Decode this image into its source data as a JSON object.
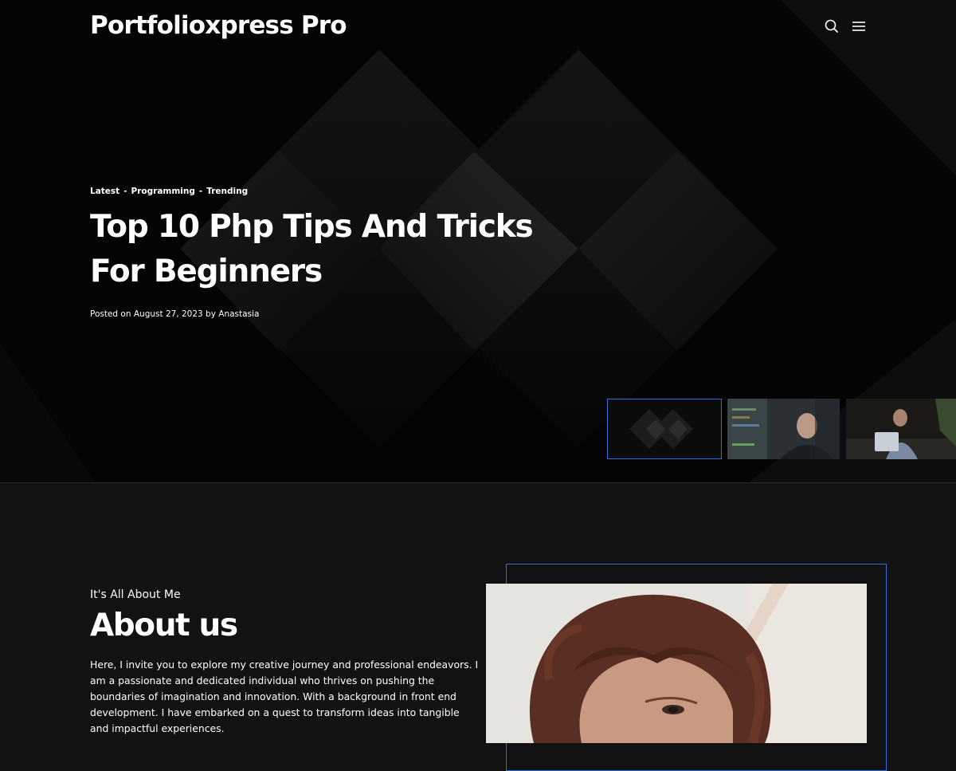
{
  "site": {
    "title": "Portfolioxpress Pro"
  },
  "header": {
    "search_icon": "search-icon",
    "menu_icon": "hamburger-menu-icon"
  },
  "slide": {
    "categories": [
      "Latest",
      "Programming",
      "Trending"
    ],
    "separator": "-",
    "title": "Top 10 Php Tips And Tricks For Beginners",
    "posted_prefix": "Posted on",
    "date": "August 27, 2023",
    "by_prefix": "by",
    "author": "Anastasia"
  },
  "thumbnails": [
    {
      "label": "slide-1",
      "active": true
    },
    {
      "label": "slide-2",
      "active": false
    },
    {
      "label": "slide-3",
      "active": false
    }
  ],
  "about": {
    "subtitle": "It's All About Me",
    "title": "About us",
    "text": "Here, I invite you to explore my creative journey and professional endeavors. I am a passionate and dedicated individual who thrives on pushing the boundaries of imagination and innovation. With a background in front end development. I have embarked on a quest to transform ideas into tangible and impactful experiences."
  },
  "colors": {
    "accent": "#2f6fd6",
    "background": "#121212",
    "hero_background": "#050505",
    "text": "#ffffff"
  }
}
